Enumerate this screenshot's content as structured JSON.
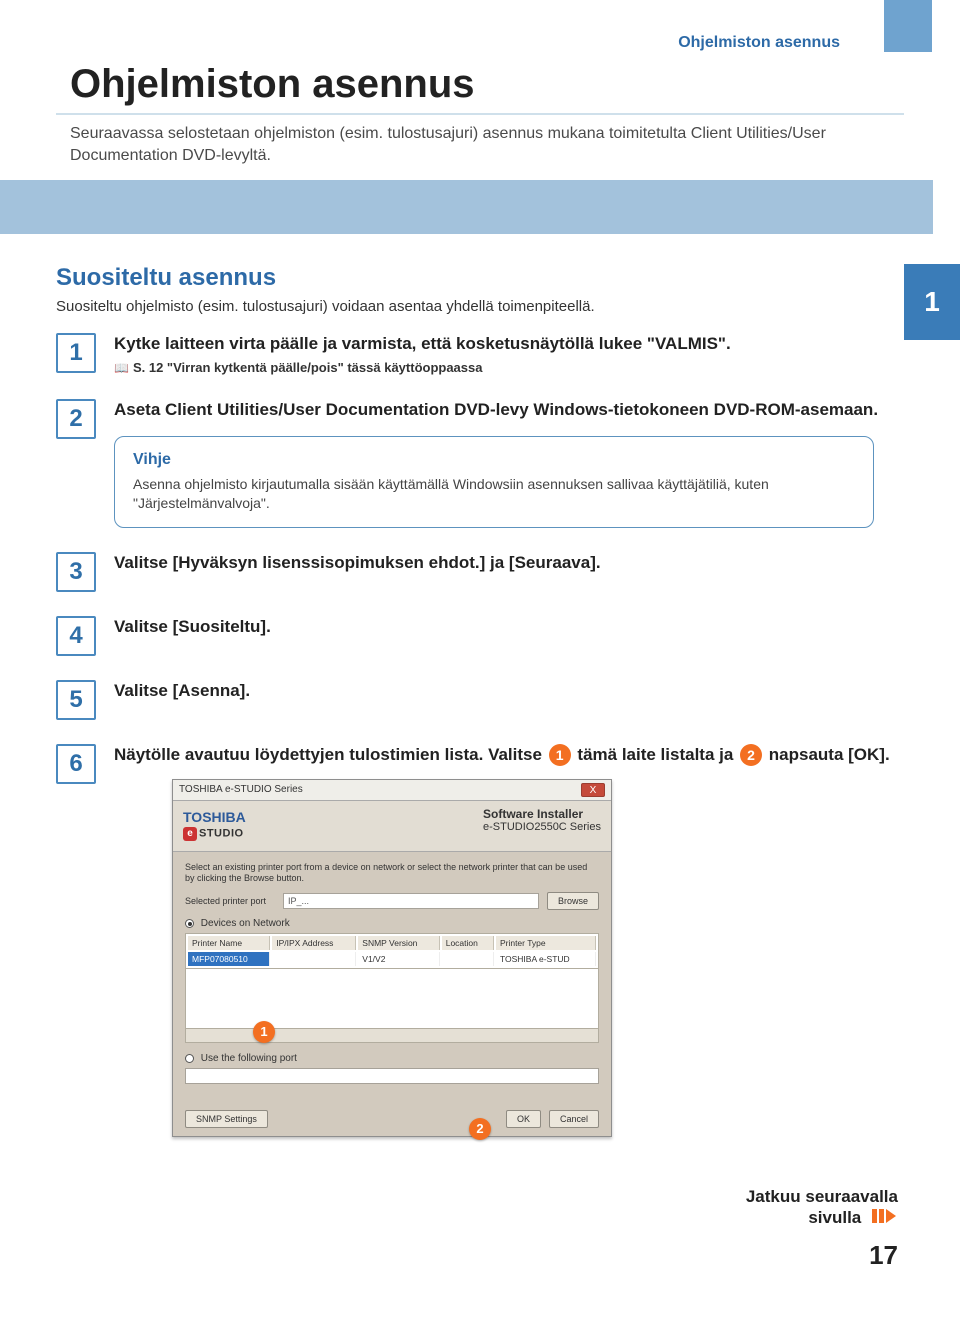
{
  "header": {
    "breadcrumb": "Ohjelmiston asennus",
    "title": "Ohjelmiston asennus",
    "intro": "Seuraavassa selostetaan ohjelmiston (esim. tulostusajuri) asennus mukana toimitetulta Client Utilities/User Documentation DVD-levyltä."
  },
  "section": {
    "title": "Suositeltu asennus",
    "lead": "Suositeltu ohjelmisto (esim. tulostusajuri) voidaan asentaa yhdellä toimenpiteellä.",
    "side_tab": "1"
  },
  "steps": [
    {
      "num": "1",
      "text": "Kytke laitteen virta päälle ja varmista, että kosketusnäytöllä lukee \"VALMIS\".",
      "ref": "S. 12 \"Virran kytkentä päälle/pois\" tässä käyttöoppaassa"
    },
    {
      "num": "2",
      "text": "Aseta Client Utilities/User Documentation DVD-levy Windows-tietokoneen DVD-ROM-asemaan.",
      "tip_title": "Vihje",
      "tip_text": "Asenna ohjelmisto kirjautumalla sisään käyttämällä Windowsiin asennuksen sallivaa käyttäjätiliä, kuten \"Järjestelmänvalvoja\"."
    },
    {
      "num": "3",
      "text": "Valitse [Hyväksyn lisenssisopimuksen ehdot.] ja [Seuraava]."
    },
    {
      "num": "4",
      "text": "Valitse [Suositeltu]."
    },
    {
      "num": "5",
      "text": "Valitse [Asenna]."
    },
    {
      "num": "6",
      "text_before": "Näytölle avautuu löydettyjen tulostimien lista. Valitse ",
      "circle1": "1",
      "text_mid": " tämä laite listalta ja ",
      "circle2": "2",
      "text_after": " napsauta [OK]."
    }
  ],
  "installer": {
    "titlebar": "TOSHIBA e-STUDIO Series",
    "brand": "TOSHIBA",
    "logo_e": "e",
    "logo_text": "STUDIO",
    "head_right1": "Software Installer",
    "head_right2": "e-STUDIO2550C Series",
    "instruction": "Select an existing printer port from a device on network or select the network printer that can be used by clicking the Browse button.",
    "selected_label": "Selected printer port",
    "selected_value": "IP_...",
    "browse": "Browse",
    "radio1": "Devices on Network",
    "columns": [
      "Printer Name",
      "IP/IPX Address",
      "SNMP Version",
      "Location",
      "Printer Type"
    ],
    "row": {
      "name": "MFP07080510",
      "ip": "",
      "snmp": "V1/V2",
      "loc": "",
      "type": "TOSHIBA e-STUD"
    },
    "radio2": "Use the following port",
    "snmp_btn": "SNMP Settings",
    "ok_btn": "OK",
    "cancel_btn": "Cancel",
    "close_x": "X",
    "callout1": "1",
    "callout2": "2"
  },
  "footer": {
    "continue_line1": "Jatkuu seuraavalla",
    "continue_line2": "sivulla",
    "page_number": "17"
  }
}
